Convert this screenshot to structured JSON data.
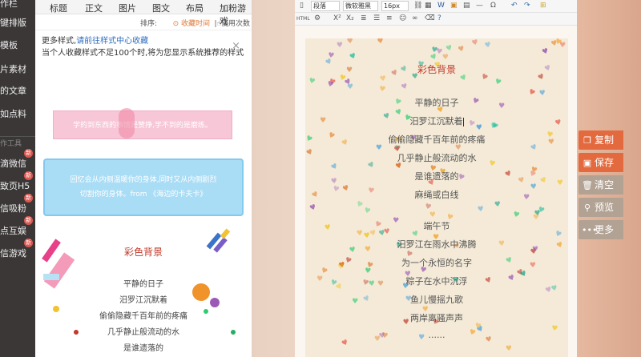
{
  "sidebar": {
    "items": [
      {
        "label": "作栏",
        "badge": ""
      },
      {
        "label": "键排版",
        "badge": ""
      },
      {
        "label": "模板",
        "badge": ""
      },
      {
        "label": "片素材",
        "badge": ""
      },
      {
        "label": "的文章",
        "badge": ""
      },
      {
        "label": "如点料",
        "badge": ""
      },
      {
        "label": "作工具",
        "badge": ""
      },
      {
        "label": "滴微信",
        "badge": "新"
      },
      {
        "label": "致页H5",
        "badge": "新"
      },
      {
        "label": "信吸粉",
        "badge": "新"
      },
      {
        "label": "点互娱",
        "badge": "新"
      },
      {
        "label": "信游戏",
        "badge": "新"
      }
    ]
  },
  "panel": {
    "tabs": [
      "标题",
      "正文",
      "图片",
      "图文",
      "布局",
      "加粉游戏"
    ],
    "sort_label": "排序:",
    "sort_by_time": "收藏时间",
    "sort_by_use": "使用次数",
    "notice_prefix": "更多样式,",
    "notice_link": "请前往样式中心收藏",
    "notice_body": "当个人收藏样式不足100个时,将为您显示系统推荐的样式",
    "close_label": "×",
    "pink_card_text": "学的到东西的事情是赞挣,学不到的是磨练。",
    "blue_card_lines": [
      "回忆会从内侧温暖你的身体,同时又从内侧剧烈",
      "切割你的身体。from 《海边的卡夫卡》"
    ],
    "preview_title": "彩色背景",
    "preview_lines": [
      "平静的日子",
      "汨罗江沉默着",
      "偷偷隐藏千百年前的疼痛",
      "几乎静止般流动的水",
      "是谁遗落的"
    ]
  },
  "editor": {
    "toolbar": {
      "paragraph": "段落",
      "font": "微软雅黑",
      "size": "16px"
    },
    "doc_title": "彩色背景",
    "doc_lines": [
      "平静的日子",
      "汨罗江沉默着",
      "偷偷隐藏千百年前的疼痛",
      "几乎静止般流动的水",
      "是谁遗落的",
      "麻绳或白线",
      "",
      "端午节",
      "汨罗江在雨水中沸腾",
      "为一个永恒的名字",
      "粽子在水中沉浮",
      "鱼儿慢摇九歌",
      "两岸离骚声声",
      "......"
    ]
  },
  "actions": {
    "copy": "复制",
    "save": "保存",
    "clear": "清空",
    "preview": "预览",
    "more": "更多"
  },
  "colors": {
    "action_accent": "#e36a3e",
    "action_muted": "#b2a294",
    "title_red": "#c0392b",
    "link_blue": "#2d6cc0"
  }
}
